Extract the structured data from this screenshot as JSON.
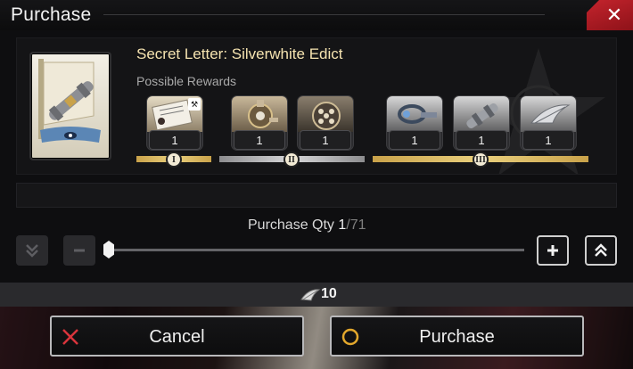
{
  "header": {
    "title": "Purchase",
    "close_glyph": "✕"
  },
  "item": {
    "name": "Secret Letter: Silverwhite Edict",
    "possible_rewards_label": "Possible Rewards",
    "icon": "scroll-letter-icon"
  },
  "rewards": [
    {
      "qty": "1",
      "icon": "letter-card-icon",
      "tier": "I",
      "badge": "hammer-badge-icon"
    },
    {
      "qty": "1",
      "icon": "gear-ornament-icon",
      "tier": "II"
    },
    {
      "qty": "1",
      "icon": "orb-sphere-icon",
      "tier": "II"
    },
    {
      "qty": "1",
      "icon": "chain-ring-icon",
      "tier": "III"
    },
    {
      "qty": "1",
      "icon": "silver-tube-icon",
      "tier": "III"
    },
    {
      "qty": "1",
      "icon": "feather-scroll-icon",
      "tier": "III"
    }
  ],
  "tiers": [
    {
      "label": "I",
      "color": "#d9b65e"
    },
    {
      "label": "II",
      "color": "#c7c7c9"
    },
    {
      "label": "III",
      "color": "#d9b65e"
    }
  ],
  "quantity": {
    "label": "Purchase Qty ",
    "current": "1",
    "separator": "/",
    "max": "71",
    "slider_fraction": 0.0
  },
  "controls": {
    "min_icon": "double-chevron-down-icon",
    "decrement_icon": "minus-icon",
    "increment_icon": "plus-icon",
    "max_icon": "double-chevron-up-icon"
  },
  "cost": {
    "icon": "feather-currency-icon",
    "value": "10"
  },
  "buttons": {
    "cancel_label": "Cancel",
    "purchase_label": "Purchase"
  },
  "colors": {
    "close_red": "#c4242d",
    "cancel_icon_red": "#d9343c",
    "purchase_icon_gold": "#e2a72c",
    "tier_gold": "#d9b65e",
    "tier_silver": "#c7c7c9"
  }
}
